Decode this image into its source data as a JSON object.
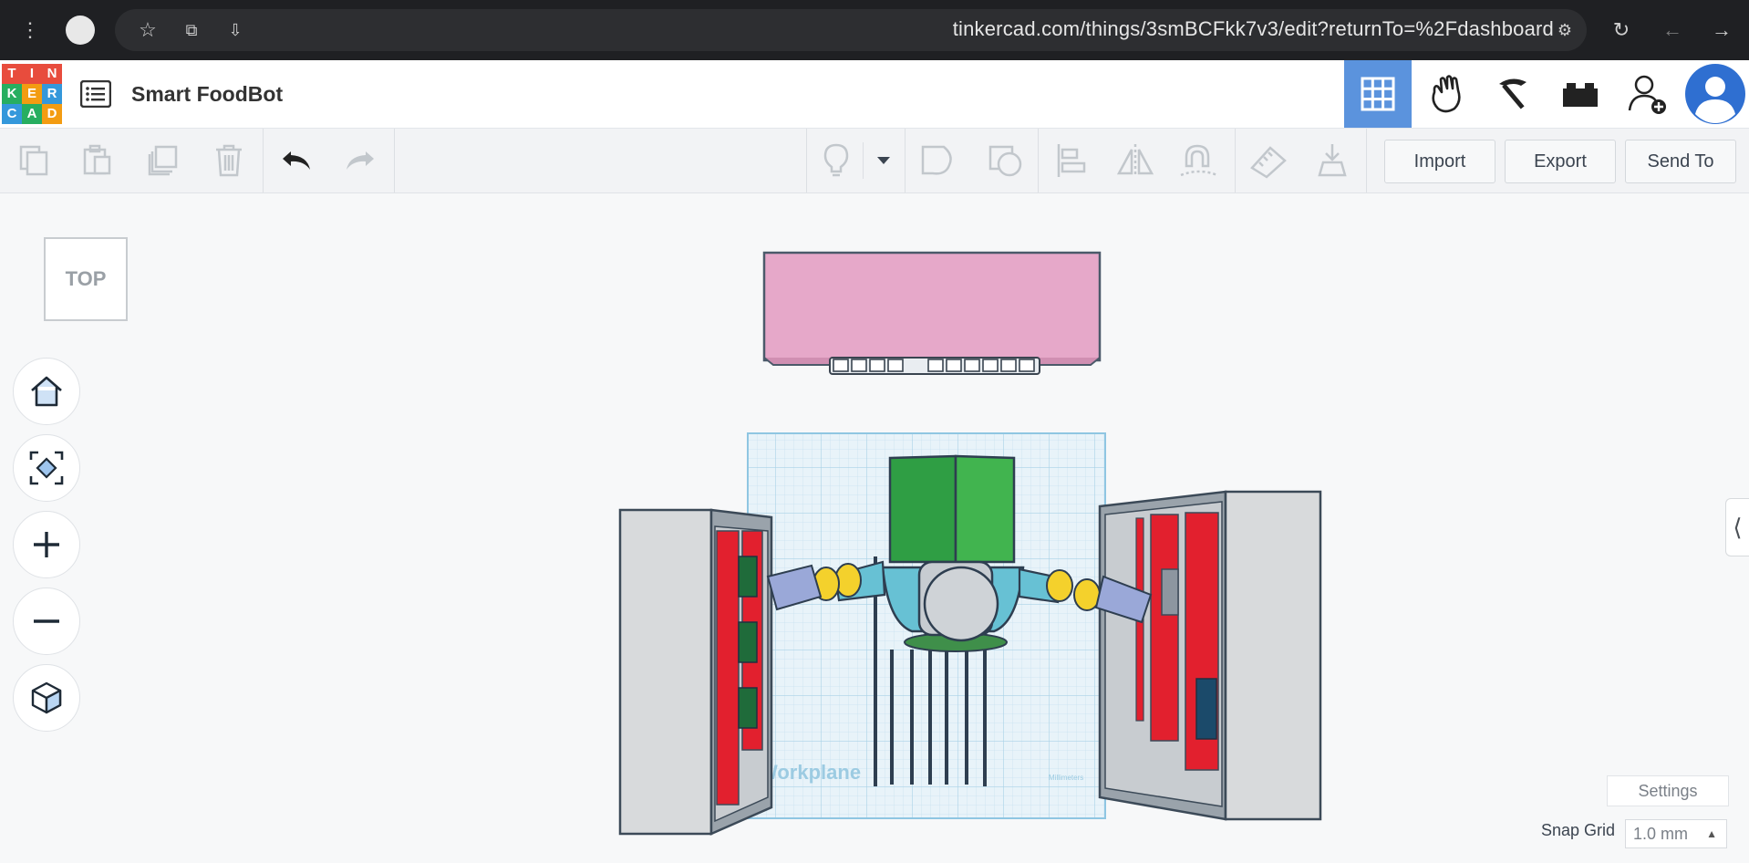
{
  "browser": {
    "url": "tinkercad.com/things/3smBCFkk7v3/edit?returnTo=%2Fdashboard"
  },
  "app": {
    "logo_letters": [
      "T",
      "I",
      "N",
      "K",
      "E",
      "R",
      "C",
      "A",
      "D"
    ],
    "logo_colors": [
      "#e84c3d",
      "#e84c3d",
      "#e84c3d",
      "#27ae60",
      "#f39c12",
      "#3498db",
      "#3498db",
      "#27ae60",
      "#f39c12"
    ],
    "title": "Smart FoodBot",
    "header_icons": [
      "3d-design-grid-icon",
      "circuits-hand-icon",
      "codeblocks-pickaxe-icon",
      "bricks-icon",
      "invite-user-icon",
      "user-avatar-icon"
    ],
    "accent_color": "#4e8fdc"
  },
  "toolbar": {
    "left_icons": [
      "copy-icon",
      "paste-icon",
      "duplicate-icon",
      "delete-icon",
      "undo-icon",
      "redo-icon"
    ],
    "right_icons": [
      "light-bulb-icon",
      "dropdown-icon",
      "group-icon",
      "ungroup-icon",
      "align-icon",
      "mirror-icon",
      "magnet-icon",
      "ruler-icon",
      "drop-to-workplane-icon"
    ],
    "import_label": "Import",
    "export_label": "Export",
    "send_to_label": "Send To"
  },
  "workspace": {
    "viewcube_label": "TOP",
    "nav_buttons": [
      "home-view-icon",
      "fit-view-icon",
      "zoom-in-icon",
      "zoom-out-icon",
      "perspective-cube-icon"
    ],
    "workplane_label": "Workplane",
    "workplane_unit": "Millimeters",
    "settings_label": "Settings",
    "snap_grid_label": "Snap Grid",
    "snap_grid_value": "1.0 mm"
  }
}
